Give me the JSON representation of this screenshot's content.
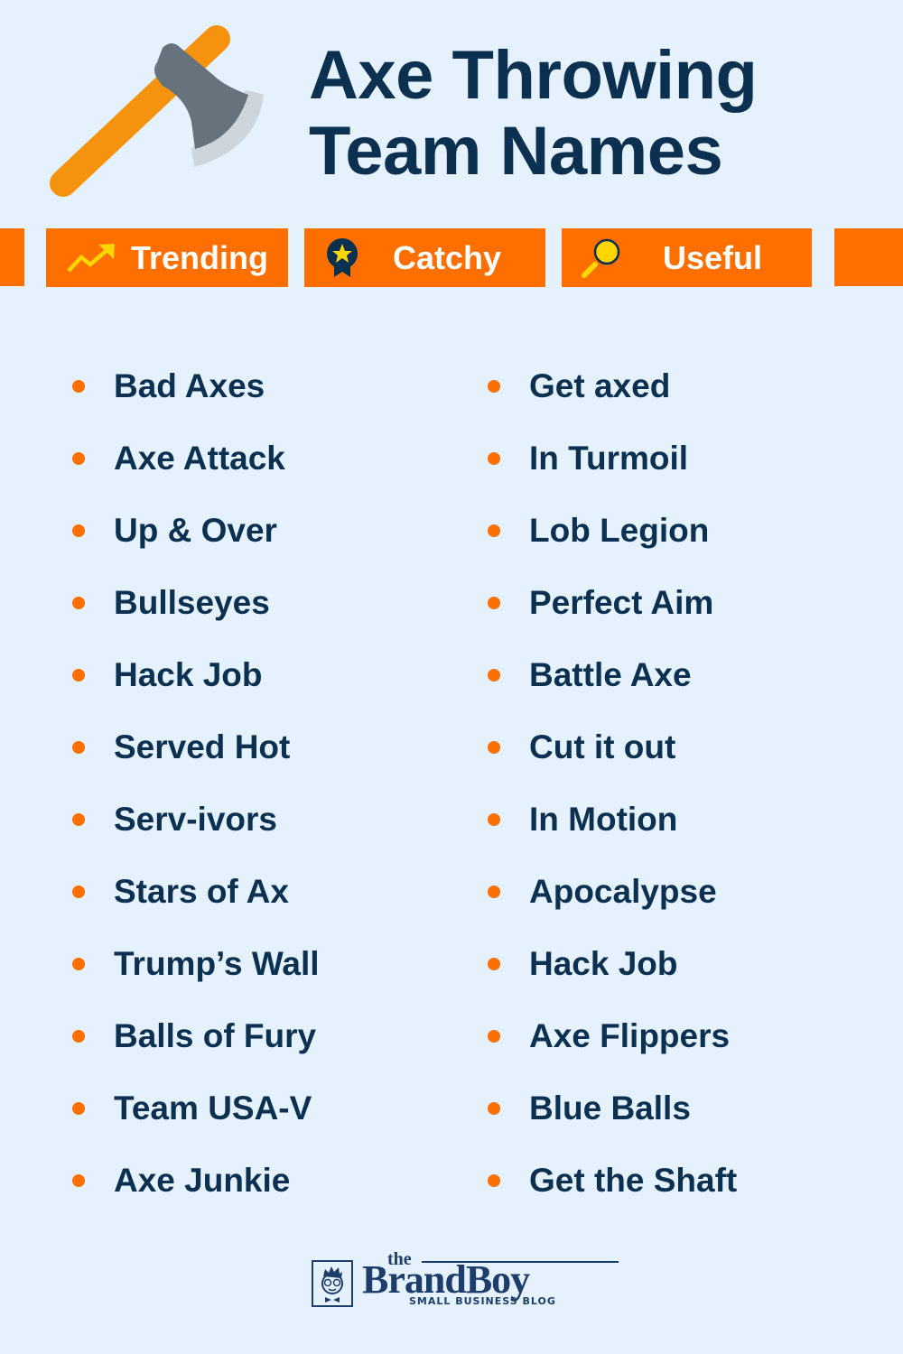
{
  "header": {
    "title_line1": "Axe Throwing",
    "title_line2": "Team Names",
    "icon": "axe-icon"
  },
  "tabs": [
    {
      "label": "Trending",
      "icon": "trending-up-icon"
    },
    {
      "label": "Catchy",
      "icon": "award-ribbon-icon"
    },
    {
      "label": "Useful",
      "icon": "magnifier-icon"
    }
  ],
  "names": {
    "left": [
      "Bad Axes",
      "Axe Attack",
      "Up & Over",
      "Bullseyes",
      "Hack Job",
      "Served Hot",
      "Serv-ivors",
      "Stars of Ax",
      "Trump’s Wall",
      "Balls of Fury",
      "Team USA-V",
      "Axe Junkie"
    ],
    "right": [
      "Get axed",
      "In Turmoil",
      "Lob Legion",
      "Perfect Aim",
      "Battle Axe",
      "Cut it out",
      "In Motion",
      "Apocalypse",
      "Hack Job",
      "Axe Flippers",
      "Blue Balls",
      "Get the Shaft"
    ]
  },
  "footer": {
    "logo_the": "the",
    "logo_brand": "BrandBoy",
    "logo_tagline": "SMALL BUSINESS BLOG"
  },
  "colors": {
    "background": "#e5f1fd",
    "accent_orange": "#ff6f00",
    "navy_text": "#0c3050",
    "icon_yellow": "#ffd600"
  }
}
